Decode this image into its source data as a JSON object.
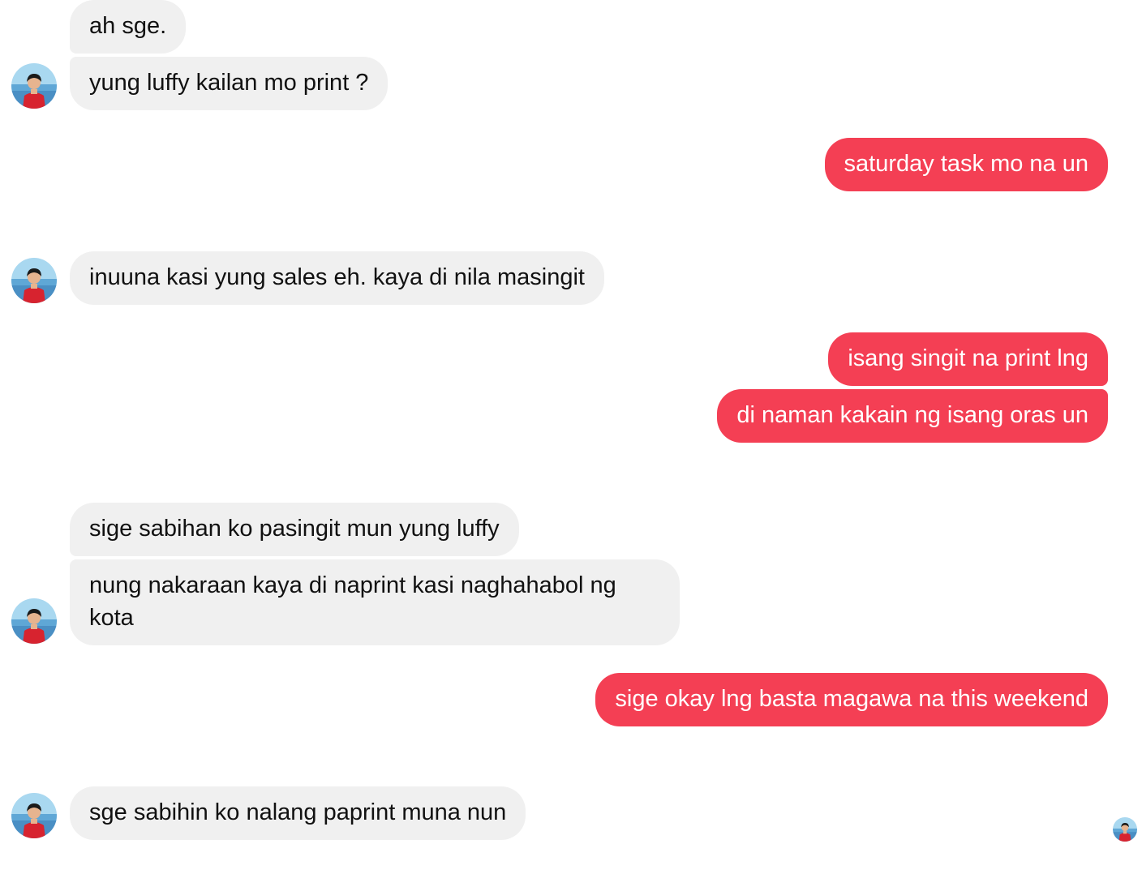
{
  "messages": [
    {
      "id": "m1",
      "side": "in",
      "text": "ah sge."
    },
    {
      "id": "m2",
      "side": "in",
      "text": "yung luffy kailan mo print ?"
    },
    {
      "id": "m3",
      "side": "out",
      "text": "saturday task mo na un"
    },
    {
      "id": "m4",
      "side": "in",
      "text": "inuuna kasi yung sales eh. kaya di nila masingit"
    },
    {
      "id": "m5",
      "side": "out",
      "text": "isang singit na print lng"
    },
    {
      "id": "m6",
      "side": "out",
      "text": "di naman kakain ng isang oras un"
    },
    {
      "id": "m7",
      "side": "in",
      "text": "sige sabihan ko pasingit mun yung luffy"
    },
    {
      "id": "m8",
      "side": "in",
      "text": "nung nakaraan kaya di naprint kasi naghahabol ng kota"
    },
    {
      "id": "m9",
      "side": "out",
      "text": "sige okay lng basta magawa na this weekend"
    },
    {
      "id": "m10",
      "side": "in",
      "text": "sge sabihin ko nalang paprint muna nun"
    }
  ],
  "colors": {
    "incoming_bubble": "#f0f0f0",
    "outgoing_bubble": "#f43f54",
    "outgoing_text": "#ffffff",
    "incoming_text": "#111111"
  },
  "icons": {
    "contact_avatar": "contact-avatar-icon",
    "read_receipt": "read-receipt-avatar-icon"
  }
}
